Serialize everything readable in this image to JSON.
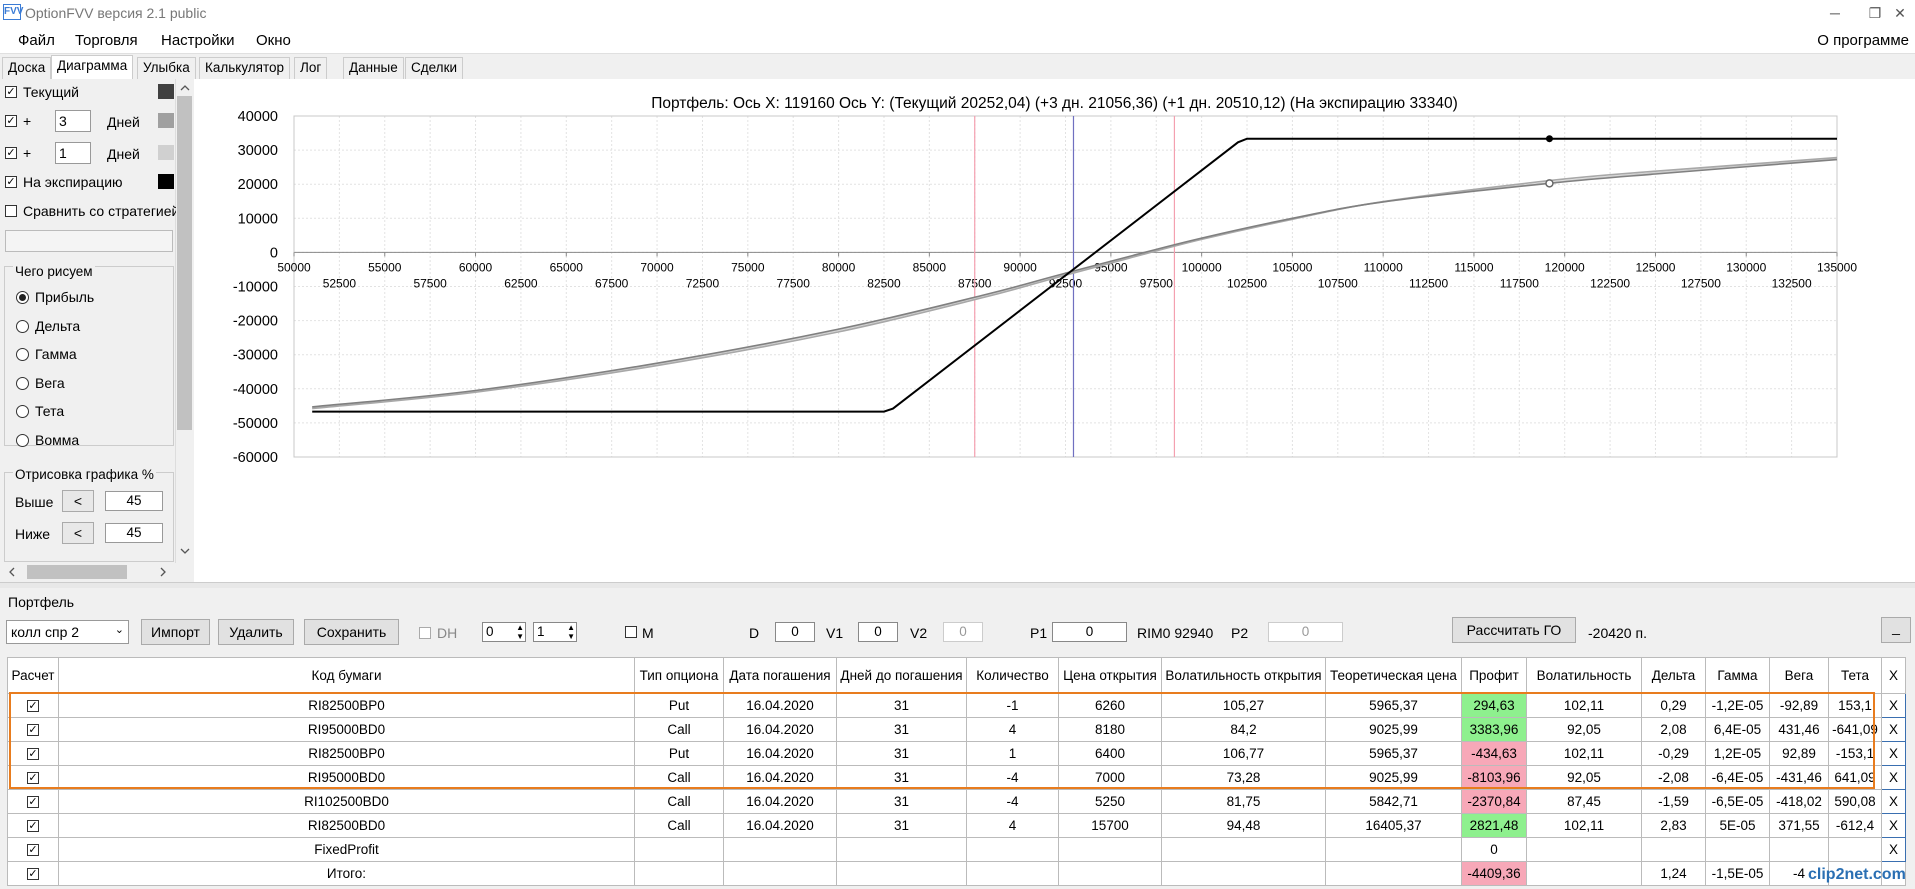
{
  "window": {
    "title": "OptionFVV версия 2.1 public",
    "icon_label": "FVV",
    "controls": [
      "─",
      "❐",
      "✕"
    ]
  },
  "menu": {
    "items": [
      "Файл",
      "Торговля",
      "Настройки",
      "Окно"
    ],
    "about": "О программе"
  },
  "tabs": [
    "Доска",
    "Диаграмма",
    "Улыбка",
    "Калькулятор",
    "Лог",
    "Данные",
    "Сделки"
  ],
  "active_tab": "Диаграмма",
  "left_panel": {
    "current_label": "Текущий",
    "plus_label": "+",
    "days_label": "Дней",
    "days1": "3",
    "days2": "1",
    "expiry_label": "На экспирацию",
    "compare_label": "Сравнить со стратегией",
    "what_to_draw": "Чего рисуем",
    "radios": [
      "Прибыль",
      "Дельта",
      "Гамма",
      "Вега",
      "Тета",
      "Вомма"
    ],
    "selected_radio": "Прибыль",
    "draw_percent": "Отрисовка графика %",
    "above_label": "Выше",
    "below_label": "Ниже",
    "step_button": "<",
    "above_value": "45",
    "below_value": "45",
    "colors": {
      "current": "#404040",
      "plus3": "#a0a0a0",
      "plus1": "#d0d0d0",
      "expiry": "#000000"
    }
  },
  "chart_data": {
    "type": "line",
    "title": "Портфель: Ось X: 119160 Ось Y:  (Текущий 20252,04)  (+3 дн. 21056,36)  (+1 дн. 20510,12)  (На экспирацию 33340)",
    "xlim": [
      50000,
      135000
    ],
    "ylim": [
      -60000,
      40000
    ],
    "y_ticks": [
      "40000",
      "30000",
      "20000",
      "10000",
      "0",
      "-10000",
      "-20000",
      "-30000",
      "-40000",
      "-50000",
      "-60000"
    ],
    "x_ticks_major": [
      "50000",
      "55000",
      "60000",
      "65000",
      "70000",
      "75000",
      "80000",
      "85000",
      "90000",
      "95000",
      "100000",
      "105000",
      "110000",
      "115000",
      "120000",
      "125000",
      "130000",
      "135000"
    ],
    "x_ticks_minor": [
      "52500",
      "57500",
      "62500",
      "67500",
      "72500",
      "77500",
      "82500",
      "87500",
      "92500",
      "97500",
      "102500",
      "107500",
      "112500",
      "117500",
      "122500",
      "127500",
      "132500"
    ],
    "vlines": [
      {
        "x": 87500,
        "color": "#f4a0b0"
      },
      {
        "x": 92940,
        "color": "#7070c0"
      },
      {
        "x": 98500,
        "color": "#f4a0b0"
      }
    ],
    "cursor_x": 119160,
    "series": [
      {
        "key": "expiry",
        "color": "#000000",
        "x": [
          51000,
          82500,
          83000,
          102000,
          102500,
          135000
        ],
        "y": [
          -46700,
          -46700,
          -45800,
          32300,
          33340,
          33340
        ]
      },
      {
        "key": "current",
        "color": "#808080",
        "x": [
          51000,
          60000,
          70000,
          80000,
          88000,
          92000,
          96000,
          100000,
          105000,
          110000,
          119160,
          125000,
          135000
        ],
        "y": [
          -45300,
          -40500,
          -32500,
          -22500,
          -12500,
          -6800,
          -1200,
          4200,
          10000,
          14800,
          20250,
          23000,
          27200
        ]
      },
      {
        "key": "plus3",
        "color": "#a8a8a8",
        "x": [
          51000,
          60000,
          70000,
          80000,
          88000,
          92000,
          96000,
          100000,
          105000,
          110000,
          119160,
          125000,
          135000
        ],
        "y": [
          -45800,
          -41000,
          -33200,
          -23300,
          -13200,
          -7400,
          -1700,
          3800,
          9700,
          14900,
          21056,
          23800,
          27800
        ]
      },
      {
        "key": "plus1",
        "color": "#cfcfcf",
        "x": [
          51000,
          60000,
          70000,
          80000,
          88000,
          92000,
          96000,
          100000,
          105000,
          110000,
          119160,
          125000,
          135000
        ],
        "y": [
          -45500,
          -40700,
          -32800,
          -22800,
          -12800,
          -7000,
          -1400,
          4000,
          9800,
          14850,
          20510,
          23300,
          27500
        ]
      }
    ]
  },
  "portfolio": {
    "label": "Портфель",
    "select_value": "колл спр 2",
    "import_label": "Импорт",
    "delete_label": "Удалить",
    "save_label": "Сохранить",
    "dh_label": "DH",
    "spin1": "0",
    "spin2": "1",
    "m_label": "M",
    "d_label": "D",
    "d_value": "0",
    "v1_label": "V1",
    "v1_value": "0",
    "v2_label": "V2",
    "v2_value": "0",
    "p1_label": "P1",
    "p1_value": "0",
    "instrument": "RIM0 92940",
    "p2_label": "P2",
    "p2_value": "0",
    "calc_go_label": "Рассчитать ГО",
    "go_value": "-20420 п.",
    "minimize": "_"
  },
  "table": {
    "headers": [
      "Расчет",
      "Код бумаги",
      "Тип опциона",
      "Дата погашения",
      "Дней до погашения",
      "Количество",
      "Цена открытия",
      "Волатильность открытия",
      "Теоретическая цена",
      "Профит",
      "Волатильность",
      "Дельта",
      "Гамма",
      "Вега",
      "Тета",
      "X"
    ],
    "rows": [
      {
        "code": "RI82500BP0",
        "type": "Put",
        "date": "16.04.2020",
        "days": "31",
        "qty": "-1",
        "price": "6260",
        "vol_open": "105,27",
        "theo": "5965,37",
        "profit": "294,63",
        "profit_sign": "pos",
        "vol": "102,11",
        "delta": "0,29",
        "gamma": "-1,2E-05",
        "vega": "-92,89",
        "theta": "153,1",
        "x": "X"
      },
      {
        "code": "RI95000BD0",
        "type": "Call",
        "date": "16.04.2020",
        "days": "31",
        "qty": "4",
        "price": "8180",
        "vol_open": "84,2",
        "theo": "9025,99",
        "profit": "3383,96",
        "profit_sign": "pos",
        "vol": "92,05",
        "delta": "2,08",
        "gamma": "6,4E-05",
        "vega": "431,46",
        "theta": "-641,09",
        "x": "X"
      },
      {
        "code": "RI82500BP0",
        "type": "Put",
        "date": "16.04.2020",
        "days": "31",
        "qty": "1",
        "price": "6400",
        "vol_open": "106,77",
        "theo": "5965,37",
        "profit": "-434,63",
        "profit_sign": "neg",
        "vol": "102,11",
        "delta": "-0,29",
        "gamma": "1,2E-05",
        "vega": "92,89",
        "theta": "-153,1",
        "x": "X"
      },
      {
        "code": "RI95000BD0",
        "type": "Call",
        "date": "16.04.2020",
        "days": "31",
        "qty": "-4",
        "price": "7000",
        "vol_open": "73,28",
        "theo": "9025,99",
        "profit": "-8103,96",
        "profit_sign": "neg",
        "vol": "92,05",
        "delta": "-2,08",
        "gamma": "-6,4E-05",
        "vega": "-431,46",
        "theta": "641,09",
        "x": "X"
      },
      {
        "code": "RI102500BD0",
        "type": "Call",
        "date": "16.04.2020",
        "days": "31",
        "qty": "-4",
        "price": "5250",
        "vol_open": "81,75",
        "theo": "5842,71",
        "profit": "-2370,84",
        "profit_sign": "neg",
        "vol": "87,45",
        "delta": "-1,59",
        "gamma": "-6,5E-05",
        "vega": "-418,02",
        "theta": "590,08",
        "x": "X"
      },
      {
        "code": "RI82500BD0",
        "type": "Call",
        "date": "16.04.2020",
        "days": "31",
        "qty": "4",
        "price": "15700",
        "vol_open": "94,48",
        "theo": "16405,37",
        "profit": "2821,48",
        "profit_sign": "pos",
        "vol": "102,11",
        "delta": "2,83",
        "gamma": "5E-05",
        "vega": "371,55",
        "theta": "-612,4",
        "x": "X"
      },
      {
        "code": "FixedProfit",
        "type": "",
        "date": "",
        "days": "",
        "qty": "",
        "price": "",
        "vol_open": "",
        "theo": "",
        "profit": "0",
        "profit_sign": "none",
        "vol": "",
        "delta": "",
        "gamma": "",
        "vega": "",
        "theta": "",
        "x": "X"
      },
      {
        "code": "Итого:",
        "type": "",
        "date": "",
        "days": "",
        "qty": "",
        "price": "",
        "vol_open": "",
        "theo": "",
        "profit": "-4409,36",
        "profit_sign": "neg",
        "vol": "",
        "delta": "1,24",
        "gamma": "-1,5E-05",
        "vega": "-4",
        "theta": "",
        "x": ""
      }
    ]
  },
  "watermark": "clip2net.com"
}
